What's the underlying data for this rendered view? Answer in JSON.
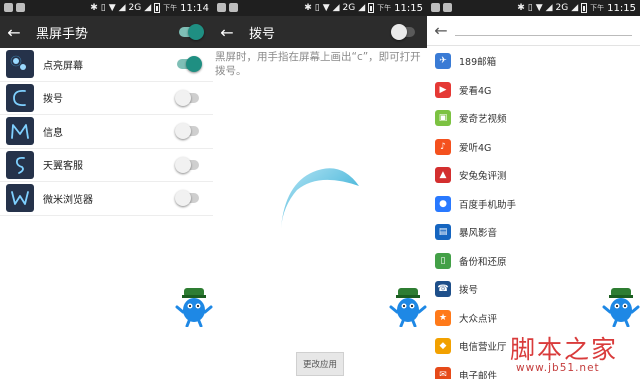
{
  "status_bars": [
    {
      "carrier": "2G",
      "speed": "下午",
      "time": "11:14"
    },
    {
      "carrier": "2G",
      "speed": "下午",
      "time": "11:15"
    },
    {
      "carrier": "2G",
      "speed": "下午",
      "time": "11:15"
    }
  ],
  "panel1": {
    "title": "黑屏手势",
    "master_toggle": true,
    "gestures": [
      {
        "label": "点亮屏幕",
        "icon": "double-dot-gesture-icon",
        "enabled": true
      },
      {
        "label": "拨号",
        "icon": "c-gesture-icon",
        "enabled": false
      },
      {
        "label": "信息",
        "icon": "m-gesture-icon",
        "enabled": false
      },
      {
        "label": "天翼客服",
        "icon": "s-gesture-icon",
        "enabled": false
      },
      {
        "label": "微米浏览器",
        "icon": "w-gesture-icon",
        "enabled": false
      }
    ]
  },
  "panel2": {
    "title": "拨号",
    "toggle": false,
    "description": "黑屏时，用手指在屏幕上画出“c”，即可打开拨号。",
    "apply_button": "更改应用"
  },
  "panel3": {
    "apps": [
      {
        "label": "189邮箱",
        "icon": "mail-plane-icon",
        "color": "#3a7bd5"
      },
      {
        "label": "爱看4G",
        "icon": "play-icon",
        "color": "#e53935"
      },
      {
        "label": "爱奇艺视频",
        "icon": "iqiyi-icon",
        "color": "#7cc242"
      },
      {
        "label": "爱听4G",
        "icon": "music-icon",
        "color": "#f4511e"
      },
      {
        "label": "安兔兔评测",
        "icon": "fire-icon",
        "color": "#d32f2f"
      },
      {
        "label": "百度手机助手",
        "icon": "baidu-icon",
        "color": "#2979ff"
      },
      {
        "label": "暴风影音",
        "icon": "film-icon",
        "color": "#1565c0"
      },
      {
        "label": "备份和还原",
        "icon": "backup-icon",
        "color": "#43a047"
      },
      {
        "label": "拨号",
        "icon": "phone-icon",
        "color": "#1e4f8a"
      },
      {
        "label": "大众点评",
        "icon": "dianping-icon",
        "color": "#ff7a1a"
      },
      {
        "label": "电信营业厅",
        "icon": "telecom-icon",
        "color": "#f2a100"
      },
      {
        "label": "电子邮件",
        "icon": "email-icon",
        "color": "#e64a19"
      }
    ]
  },
  "watermark": {
    "text": "脚本之家",
    "url": "www.jb51.net"
  },
  "colors": {
    "accent": "#1f8f82",
    "appbar": "#2c2c2c",
    "statusbar": "#1f1f1f"
  }
}
